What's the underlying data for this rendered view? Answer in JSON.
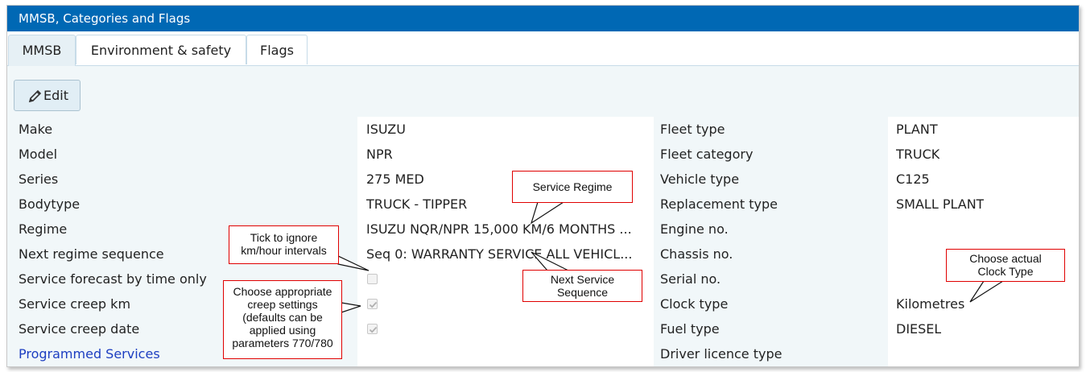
{
  "window": {
    "title": "MMSB, Categories and Flags"
  },
  "tabs": [
    {
      "label": "MMSB",
      "active": true
    },
    {
      "label": "Environment & safety",
      "active": false
    },
    {
      "label": "Flags",
      "active": false
    }
  ],
  "toolbar": {
    "edit_label": "Edit",
    "edit_icon": "pencil-icon"
  },
  "left_fields": [
    {
      "label": "Make",
      "value": "ISUZU"
    },
    {
      "label": "Model",
      "value": "NPR"
    },
    {
      "label": "Series",
      "value": "275 MED"
    },
    {
      "label": "Bodytype",
      "value": "TRUCK - TIPPER"
    },
    {
      "label": "Regime",
      "value": "ISUZU NQR/NPR 15,000 KM/6 MONTHS ..."
    },
    {
      "label": "Next regime sequence",
      "value": "Seq 0: WARRANTY SERVICE ALL VEHICL..."
    },
    {
      "label": "Service forecast by time only",
      "checked": false
    },
    {
      "label": "Service creep km",
      "checked": true
    },
    {
      "label": "Service creep date",
      "checked": true
    },
    {
      "label": "Programmed Services",
      "value": ""
    }
  ],
  "right_fields": [
    {
      "label": "Fleet type",
      "value": "PLANT"
    },
    {
      "label": "Fleet category",
      "value": "TRUCK"
    },
    {
      "label": "Vehicle type",
      "value": "C125"
    },
    {
      "label": "Replacement type",
      "value": "SMALL PLANT"
    },
    {
      "label": "Engine no.",
      "value": ""
    },
    {
      "label": "Chassis no.",
      "value": ""
    },
    {
      "label": "Serial no.",
      "value": ""
    },
    {
      "label": "Clock type",
      "value": "Kilometres"
    },
    {
      "label": "Fuel type",
      "value": "DIESEL"
    },
    {
      "label": "Driver licence type",
      "value": ""
    }
  ],
  "callouts": {
    "service_regime": "Service Regime",
    "next_sequence": "Next Service Sequence",
    "tick_ignore": "Tick to ignore km/hour intervals",
    "creep_settings": "Choose appropriate creep settings (defaults can be applied using parameters 770/780",
    "clock_type": "Choose actual Clock Type"
  },
  "colors": {
    "titlebar": "#0068b4",
    "link": "#1d3ec1",
    "callout_border": "#e00000",
    "panel": "#f1f7f9"
  }
}
